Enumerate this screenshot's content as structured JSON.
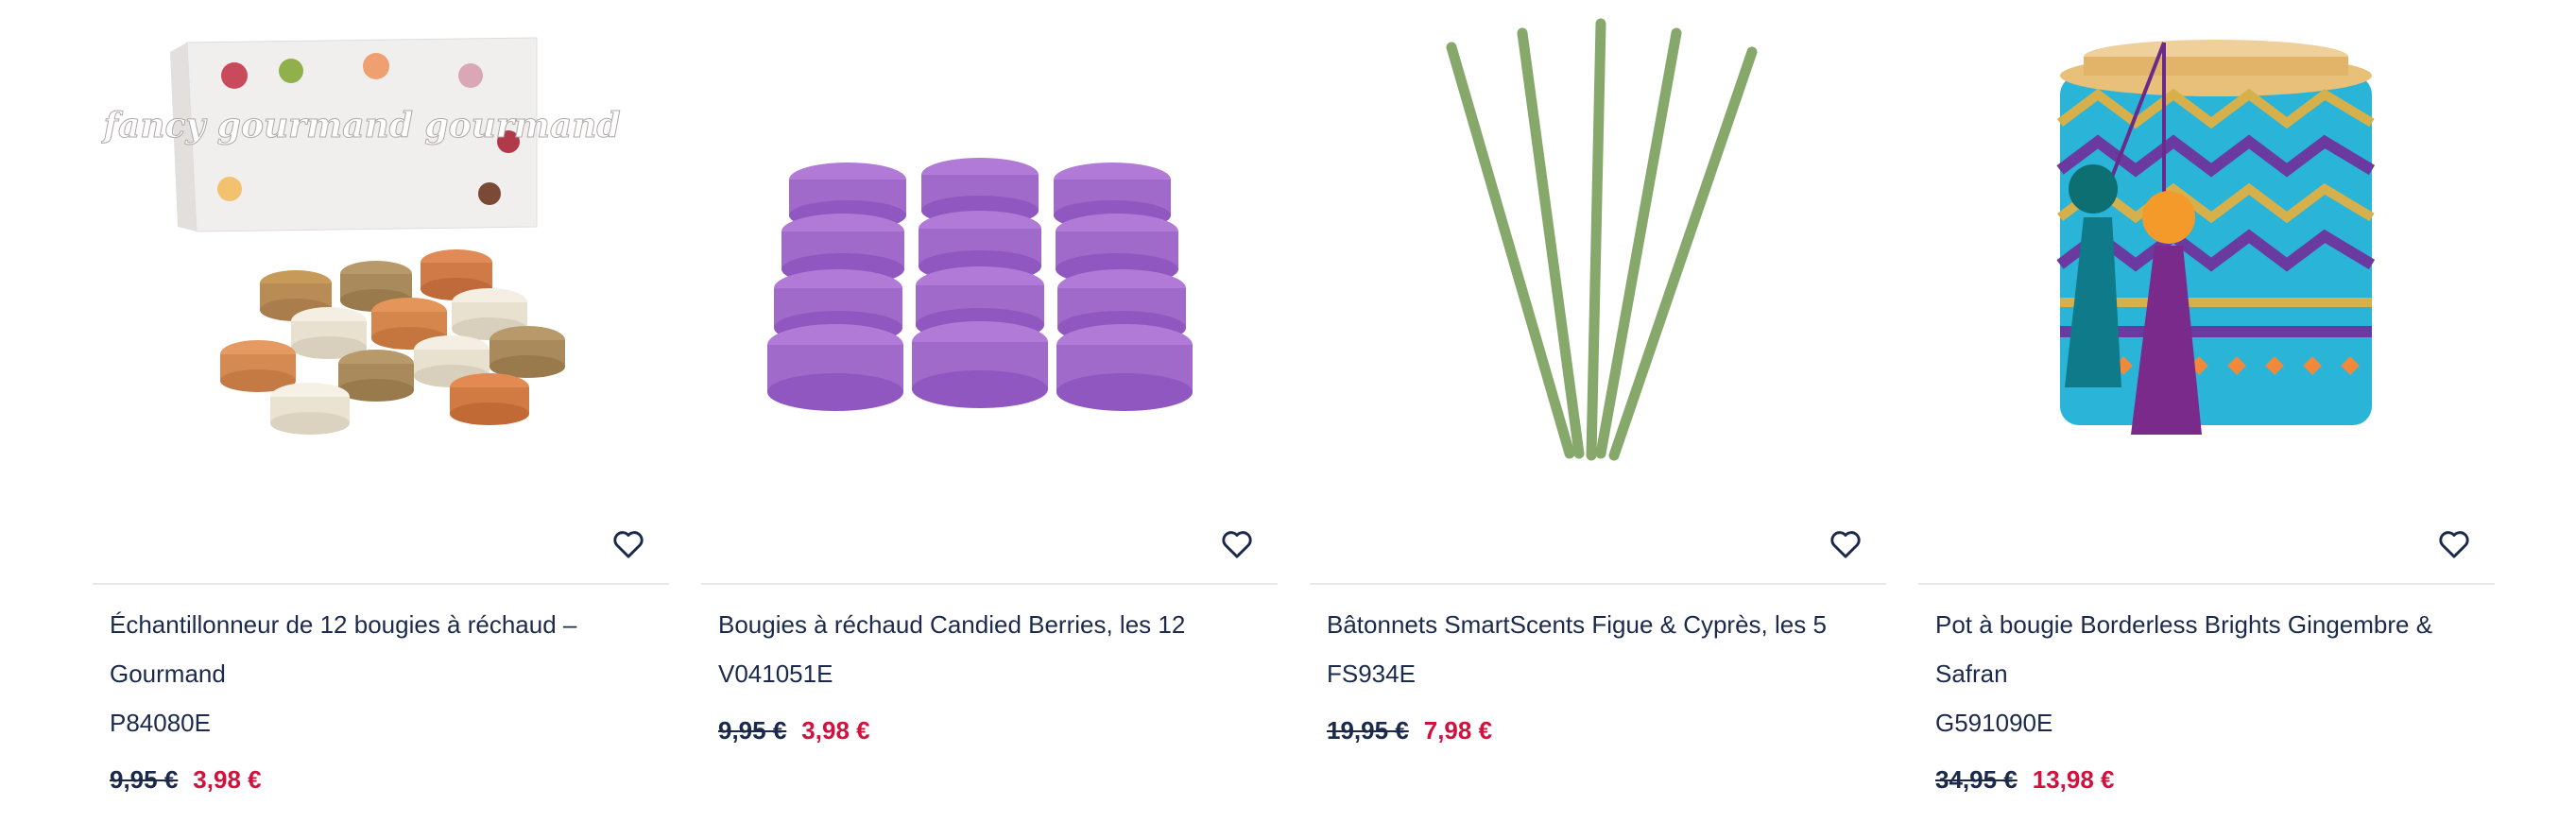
{
  "products": [
    {
      "image_desc": "macaron tealight candle box",
      "title": "Échantillonneur de 12 bougies à réchaud – Gourmand",
      "code": "P84080E",
      "old_price": "9,95 €",
      "new_price": "3,98 €",
      "box_text": "fancy gourmand gourmand"
    },
    {
      "image_desc": "purple tealights",
      "title": "Bougies à réchaud Candied Berries, les 12",
      "code": "V041051E",
      "old_price": "9,95 €",
      "new_price": "3,98 €"
    },
    {
      "image_desc": "green reed sticks",
      "title": "Bâtonnets SmartScents Figue & Cyprès, les 5",
      "code": "FS934E",
      "old_price": "19,95 €",
      "new_price": "7,98 €"
    },
    {
      "image_desc": "decorated candle pot with tassels",
      "title": "Pot à bougie Borderless Brights Gingembre & Safran",
      "code": "G591090E",
      "old_price": "34,95 €",
      "new_price": "13,98 €"
    }
  ],
  "colors": {
    "old_price": "#1b2a4a",
    "sale_price": "#d1123f",
    "text": "#1b2a4a"
  },
  "icons": {
    "favorite": "heart-outline-icon"
  }
}
